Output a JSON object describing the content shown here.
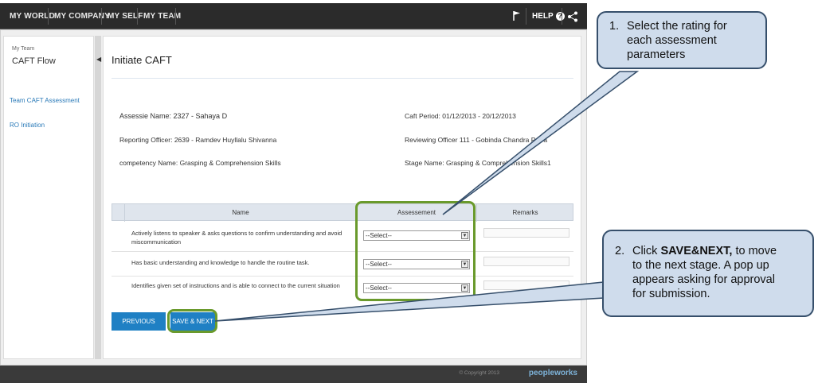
{
  "nav": {
    "items": [
      "MY WORLD",
      "MY COMPANY",
      "MY SELF",
      "MY TEAM"
    ],
    "help_label": "HELP",
    "icons": [
      "flag-icon",
      "help-icon",
      "share-icon"
    ]
  },
  "sidebar": {
    "small_label": "My Team",
    "title": "CAFT Flow",
    "links": [
      "Team CAFT Assessment",
      "RO Initiation"
    ]
  },
  "page": {
    "title": "Initiate CAFT",
    "assessee": "Assessie Name: 2327 - Sahaya D",
    "reporting_officer": "Reporting Officer: 2639 - Ramdev Huyllalu Shivanna",
    "competency": "competency Name: Grasping & Comprehension Skills",
    "caft_period": "Caft Period: 01/12/2013 - 20/12/2013",
    "reviewing_officer": "Reviewing Officer 111 - Gobinda Chandra Patra",
    "stage_name": "Stage Name: Grasping & Comprehension Skills1"
  },
  "table": {
    "headers": [
      "Name",
      "Assessement",
      "Remarks"
    ],
    "rows": [
      {
        "name": "Actively listens to speaker & asks questions to confirm understanding and avoid miscommunication",
        "assessment": "--Select--"
      },
      {
        "name": "Has basic understanding and knowledge to handle the routine task.",
        "assessment": "--Select--"
      },
      {
        "name": "Identifies given set of instructions and is able to connect to the current situation",
        "assessment": "--Select--"
      }
    ]
  },
  "buttons": {
    "previous": "PREVIOUS STAGE",
    "save_next": "SAVE & NEXT"
  },
  "footer": {
    "copyright": "© Copyright 2013",
    "brand": "peopleworks"
  },
  "callouts": {
    "one_num": "1.",
    "one_text_l1": "Select the rating for",
    "one_text_l2": "each assessment",
    "one_text_l3": "parameters",
    "two_num": "2.",
    "two_pre": "Click ",
    "two_bold": "SAVE&NEXT,",
    "two_post": " to move",
    "two_l2": "to the next stage. A pop up",
    "two_l3": "appears asking for approval",
    "two_l4": "for submission."
  },
  "colors": {
    "nav_bg": "#2b2b2b",
    "accent_blue": "#1f80c4",
    "highlight_green": "#6a9a2c",
    "callout_bg": "#cfdcec",
    "callout_border": "#364f6b"
  }
}
